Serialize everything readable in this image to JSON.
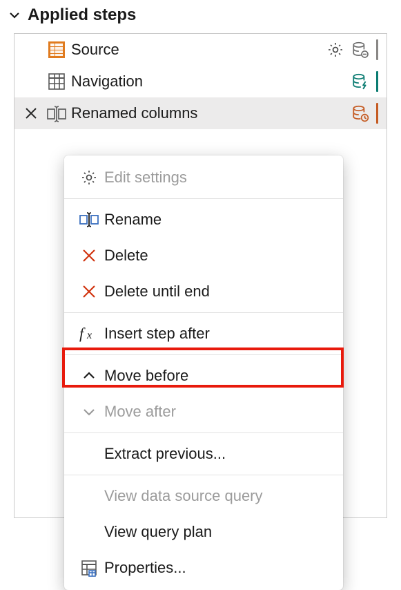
{
  "panel": {
    "title": "Applied steps"
  },
  "steps": [
    {
      "label": "Source"
    },
    {
      "label": "Navigation"
    },
    {
      "label": "Renamed columns"
    }
  ],
  "menu": {
    "editSettings": "Edit settings",
    "rename": "Rename",
    "delete": "Delete",
    "deleteUntilEnd": "Delete until end",
    "insertStepAfter": "Insert step after",
    "moveBefore": "Move before",
    "moveAfter": "Move after",
    "extractPrevious": "Extract previous...",
    "viewDataSourceQuery": "View data source query",
    "viewQueryPlan": "View query plan",
    "properties": "Properties..."
  }
}
